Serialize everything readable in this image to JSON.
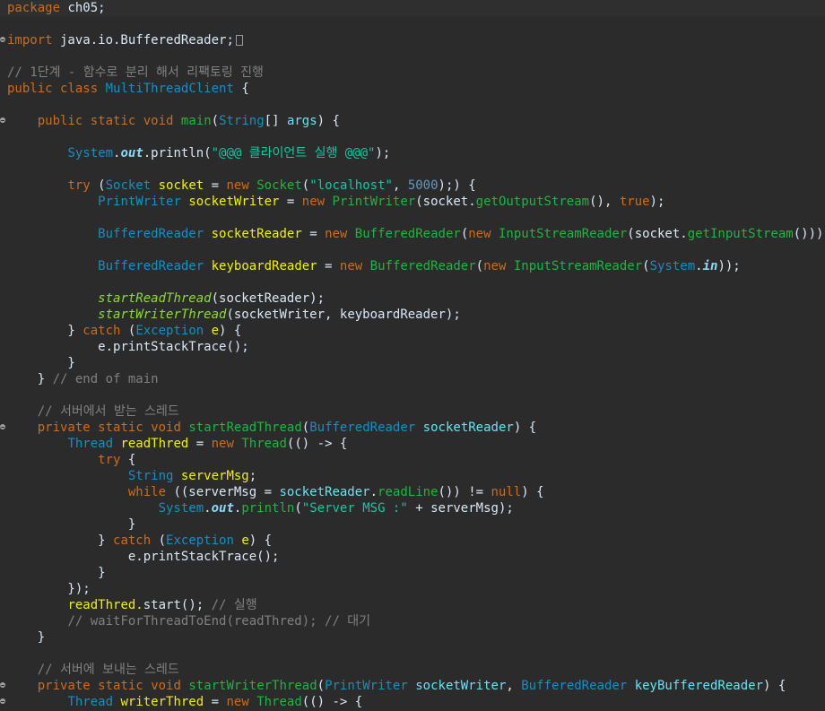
{
  "editor": {
    "lines": [
      [
        {
          "t": "package",
          "c": "kw"
        },
        {
          "t": " ch05;",
          "c": "plain"
        }
      ],
      [],
      [
        {
          "t": "import",
          "c": "kw"
        },
        {
          "t": " java.io.BufferedReader;",
          "c": "plain"
        },
        {
          "t": "",
          "c": "ellip"
        }
      ],
      [],
      [
        {
          "t": "// 1단계 - 함수로 분리 해서 리팩토링 진행",
          "c": "cm"
        }
      ],
      [
        {
          "t": "public",
          "c": "kw"
        },
        {
          "t": " ",
          "c": "plain"
        },
        {
          "t": "class",
          "c": "kw"
        },
        {
          "t": " ",
          "c": "plain"
        },
        {
          "t": "MultiThreadClient",
          "c": "ty"
        },
        {
          "t": " {",
          "c": "plain"
        }
      ],
      [],
      [
        {
          "t": "    ",
          "c": "plain"
        },
        {
          "t": "public",
          "c": "kw"
        },
        {
          "t": " ",
          "c": "plain"
        },
        {
          "t": "static",
          "c": "kw"
        },
        {
          "t": " ",
          "c": "plain"
        },
        {
          "t": "void",
          "c": "kw"
        },
        {
          "t": " ",
          "c": "plain"
        },
        {
          "t": "main",
          "c": "fn"
        },
        {
          "t": "(",
          "c": "plain"
        },
        {
          "t": "String",
          "c": "ty"
        },
        {
          "t": "[] ",
          "c": "plain"
        },
        {
          "t": "args",
          "c": "var"
        },
        {
          "t": ") {",
          "c": "plain"
        }
      ],
      [],
      [
        {
          "t": "        ",
          "c": "plain"
        },
        {
          "t": "System",
          "c": "ty"
        },
        {
          "t": ".",
          "c": "plain"
        },
        {
          "t": "out",
          "c": "sf"
        },
        {
          "t": ".println(",
          "c": "plain"
        },
        {
          "t": "\"@@@ 클라이언트 실행 @@@\"",
          "c": "st"
        },
        {
          "t": ");",
          "c": "plain"
        }
      ],
      [],
      [
        {
          "t": "        ",
          "c": "plain"
        },
        {
          "t": "try",
          "c": "kw"
        },
        {
          "t": " (",
          "c": "plain"
        },
        {
          "t": "Socket",
          "c": "ty"
        },
        {
          "t": " ",
          "c": "plain"
        },
        {
          "t": "socket",
          "c": "va"
        },
        {
          "t": " = ",
          "c": "plain"
        },
        {
          "t": "new",
          "c": "kw"
        },
        {
          "t": " ",
          "c": "plain"
        },
        {
          "t": "Socket",
          "c": "fn"
        },
        {
          "t": "(",
          "c": "plain"
        },
        {
          "t": "\"localhost\"",
          "c": "st"
        },
        {
          "t": ", ",
          "c": "plain"
        },
        {
          "t": "5000",
          "c": "nu"
        },
        {
          "t": ");) {",
          "c": "plain"
        }
      ],
      [
        {
          "t": "            ",
          "c": "plain"
        },
        {
          "t": "PrintWriter",
          "c": "ty"
        },
        {
          "t": " ",
          "c": "plain"
        },
        {
          "t": "socketWriter",
          "c": "va"
        },
        {
          "t": " = ",
          "c": "plain"
        },
        {
          "t": "new",
          "c": "kw"
        },
        {
          "t": " ",
          "c": "plain"
        },
        {
          "t": "PrintWriter",
          "c": "fn"
        },
        {
          "t": "(socket.",
          "c": "plain"
        },
        {
          "t": "getOutputStream",
          "c": "fn"
        },
        {
          "t": "(), ",
          "c": "plain"
        },
        {
          "t": "true",
          "c": "kw"
        },
        {
          "t": ");",
          "c": "plain"
        }
      ],
      [],
      [
        {
          "t": "            ",
          "c": "plain"
        },
        {
          "t": "BufferedReader",
          "c": "ty"
        },
        {
          "t": " ",
          "c": "plain"
        },
        {
          "t": "socketReader",
          "c": "va"
        },
        {
          "t": " = ",
          "c": "plain"
        },
        {
          "t": "new",
          "c": "kw"
        },
        {
          "t": " ",
          "c": "plain"
        },
        {
          "t": "BufferedReader",
          "c": "fn"
        },
        {
          "t": "(",
          "c": "plain"
        },
        {
          "t": "new",
          "c": "kw"
        },
        {
          "t": " ",
          "c": "plain"
        },
        {
          "t": "InputStreamReader",
          "c": "fn"
        },
        {
          "t": "(socket.",
          "c": "plain"
        },
        {
          "t": "getInputStream",
          "c": "fn"
        },
        {
          "t": "()));",
          "c": "plain"
        }
      ],
      [],
      [
        {
          "t": "            ",
          "c": "plain"
        },
        {
          "t": "BufferedReader",
          "c": "ty"
        },
        {
          "t": " ",
          "c": "plain"
        },
        {
          "t": "keyboardReader",
          "c": "va"
        },
        {
          "t": " = ",
          "c": "plain"
        },
        {
          "t": "new",
          "c": "kw"
        },
        {
          "t": " ",
          "c": "plain"
        },
        {
          "t": "BufferedReader",
          "c": "fn"
        },
        {
          "t": "(",
          "c": "plain"
        },
        {
          "t": "new",
          "c": "kw"
        },
        {
          "t": " ",
          "c": "plain"
        },
        {
          "t": "InputStreamReader",
          "c": "fn"
        },
        {
          "t": "(",
          "c": "plain"
        },
        {
          "t": "System",
          "c": "ty"
        },
        {
          "t": ".",
          "c": "plain"
        },
        {
          "t": "in",
          "c": "sf"
        },
        {
          "t": "));",
          "c": "plain"
        }
      ],
      [],
      [
        {
          "t": "            ",
          "c": "plain"
        },
        {
          "t": "startReadThread",
          "c": "fi"
        },
        {
          "t": "(socketReader);",
          "c": "plain"
        }
      ],
      [
        {
          "t": "            ",
          "c": "plain"
        },
        {
          "t": "startWriterThread",
          "c": "fi"
        },
        {
          "t": "(socketWriter, keyboardReader);",
          "c": "plain"
        }
      ],
      [
        {
          "t": "        } ",
          "c": "plain"
        },
        {
          "t": "catch",
          "c": "kw"
        },
        {
          "t": " (",
          "c": "plain"
        },
        {
          "t": "Exception",
          "c": "ty"
        },
        {
          "t": " ",
          "c": "plain"
        },
        {
          "t": "e",
          "c": "va"
        },
        {
          "t": ") {",
          "c": "plain"
        }
      ],
      [
        {
          "t": "            e.",
          "c": "plain"
        },
        {
          "t": "printStackTrace",
          "c": "plain"
        },
        {
          "t": "();",
          "c": "plain"
        }
      ],
      [
        {
          "t": "        }",
          "c": "plain"
        }
      ],
      [
        {
          "t": "    } ",
          "c": "plain"
        },
        {
          "t": "// end of main",
          "c": "cm"
        }
      ],
      [],
      [
        {
          "t": "    ",
          "c": "plain"
        },
        {
          "t": "// 서버에서 받는 스레드",
          "c": "cm"
        }
      ],
      [
        {
          "t": "    ",
          "c": "plain"
        },
        {
          "t": "private",
          "c": "kw"
        },
        {
          "t": " ",
          "c": "plain"
        },
        {
          "t": "static",
          "c": "kw"
        },
        {
          "t": " ",
          "c": "plain"
        },
        {
          "t": "void",
          "c": "kw"
        },
        {
          "t": " ",
          "c": "plain"
        },
        {
          "t": "startReadThread",
          "c": "fn"
        },
        {
          "t": "(",
          "c": "plain"
        },
        {
          "t": "BufferedReader",
          "c": "ty"
        },
        {
          "t": " ",
          "c": "plain"
        },
        {
          "t": "socketReader",
          "c": "var"
        },
        {
          "t": ") {",
          "c": "plain"
        }
      ],
      [
        {
          "t": "        ",
          "c": "plain"
        },
        {
          "t": "Thread",
          "c": "ty"
        },
        {
          "t": " ",
          "c": "plain"
        },
        {
          "t": "readThred",
          "c": "va"
        },
        {
          "t": " = ",
          "c": "plain"
        },
        {
          "t": "new",
          "c": "kw"
        },
        {
          "t": " ",
          "c": "plain"
        },
        {
          "t": "Thread",
          "c": "fn"
        },
        {
          "t": "(() -> {",
          "c": "plain"
        }
      ],
      [
        {
          "t": "            ",
          "c": "plain"
        },
        {
          "t": "try",
          "c": "kw"
        },
        {
          "t": " {",
          "c": "plain"
        }
      ],
      [
        {
          "t": "                ",
          "c": "plain"
        },
        {
          "t": "String",
          "c": "ty"
        },
        {
          "t": " ",
          "c": "plain"
        },
        {
          "t": "serverMsg",
          "c": "va"
        },
        {
          "t": ";",
          "c": "plain"
        }
      ],
      [
        {
          "t": "                ",
          "c": "plain"
        },
        {
          "t": "while",
          "c": "kw"
        },
        {
          "t": " ((serverMsg = ",
          "c": "plain"
        },
        {
          "t": "socketReader",
          "c": "var"
        },
        {
          "t": ".",
          "c": "plain"
        },
        {
          "t": "readLine",
          "c": "fn"
        },
        {
          "t": "()) != ",
          "c": "plain"
        },
        {
          "t": "null",
          "c": "kw"
        },
        {
          "t": ") {",
          "c": "plain"
        }
      ],
      [
        {
          "t": "                    ",
          "c": "plain"
        },
        {
          "t": "System",
          "c": "ty"
        },
        {
          "t": ".",
          "c": "plain"
        },
        {
          "t": "out",
          "c": "sf"
        },
        {
          "t": ".",
          "c": "plain"
        },
        {
          "t": "println",
          "c": "fn"
        },
        {
          "t": "(",
          "c": "plain"
        },
        {
          "t": "\"Server MSG :\"",
          "c": "st"
        },
        {
          "t": " + serverMsg);",
          "c": "plain"
        }
      ],
      [
        {
          "t": "                }",
          "c": "plain"
        }
      ],
      [
        {
          "t": "            } ",
          "c": "plain"
        },
        {
          "t": "catch",
          "c": "kw"
        },
        {
          "t": " (",
          "c": "plain"
        },
        {
          "t": "Exception",
          "c": "ty"
        },
        {
          "t": " ",
          "c": "plain"
        },
        {
          "t": "e",
          "c": "va"
        },
        {
          "t": ") {",
          "c": "plain"
        }
      ],
      [
        {
          "t": "                e.",
          "c": "plain"
        },
        {
          "t": "printStackTrace",
          "c": "plain"
        },
        {
          "t": "();",
          "c": "plain"
        }
      ],
      [
        {
          "t": "            }",
          "c": "plain"
        }
      ],
      [
        {
          "t": "        });",
          "c": "plain"
        }
      ],
      [
        {
          "t": "        ",
          "c": "plain"
        },
        {
          "t": "readThred.",
          "c": "va"
        },
        {
          "t": "start",
          "c": "plain"
        },
        {
          "t": "(); ",
          "c": "plain"
        },
        {
          "t": "// 실행",
          "c": "cm"
        }
      ],
      [
        {
          "t": "        ",
          "c": "plain"
        },
        {
          "t": "// waitForThreadToEnd(readThred); // 대기",
          "c": "cm"
        }
      ],
      [
        {
          "t": "    }",
          "c": "plain"
        }
      ],
      [],
      [
        {
          "t": "    ",
          "c": "plain"
        },
        {
          "t": "// 서버에 보내는 스레드",
          "c": "cm"
        }
      ],
      [
        {
          "t": "    ",
          "c": "plain"
        },
        {
          "t": "private",
          "c": "kw"
        },
        {
          "t": " ",
          "c": "plain"
        },
        {
          "t": "static",
          "c": "kw"
        },
        {
          "t": " ",
          "c": "plain"
        },
        {
          "t": "void",
          "c": "kw"
        },
        {
          "t": " ",
          "c": "plain"
        },
        {
          "t": "startWriterThread",
          "c": "fn"
        },
        {
          "t": "(",
          "c": "plain"
        },
        {
          "t": "PrintWriter",
          "c": "ty"
        },
        {
          "t": " ",
          "c": "plain"
        },
        {
          "t": "socketWriter",
          "c": "var"
        },
        {
          "t": ", ",
          "c": "plain"
        },
        {
          "t": "BufferedReader",
          "c": "ty"
        },
        {
          "t": " ",
          "c": "plain"
        },
        {
          "t": "keyBufferedReader",
          "c": "var"
        },
        {
          "t": ") {",
          "c": "plain"
        }
      ],
      [
        {
          "t": "        ",
          "c": "plain"
        },
        {
          "t": "Thread",
          "c": "ty"
        },
        {
          "t": " ",
          "c": "plain"
        },
        {
          "t": "writerThred",
          "c": "va"
        },
        {
          "t": " = ",
          "c": "plain"
        },
        {
          "t": "new",
          "c": "kw"
        },
        {
          "t": " ",
          "c": "plain"
        },
        {
          "t": "Thread",
          "c": "fn"
        },
        {
          "t": "(() -> {",
          "c": "plain"
        }
      ]
    ],
    "fold_lines": [
      2,
      7,
      26,
      42,
      43
    ],
    "highlight_line": 0
  }
}
